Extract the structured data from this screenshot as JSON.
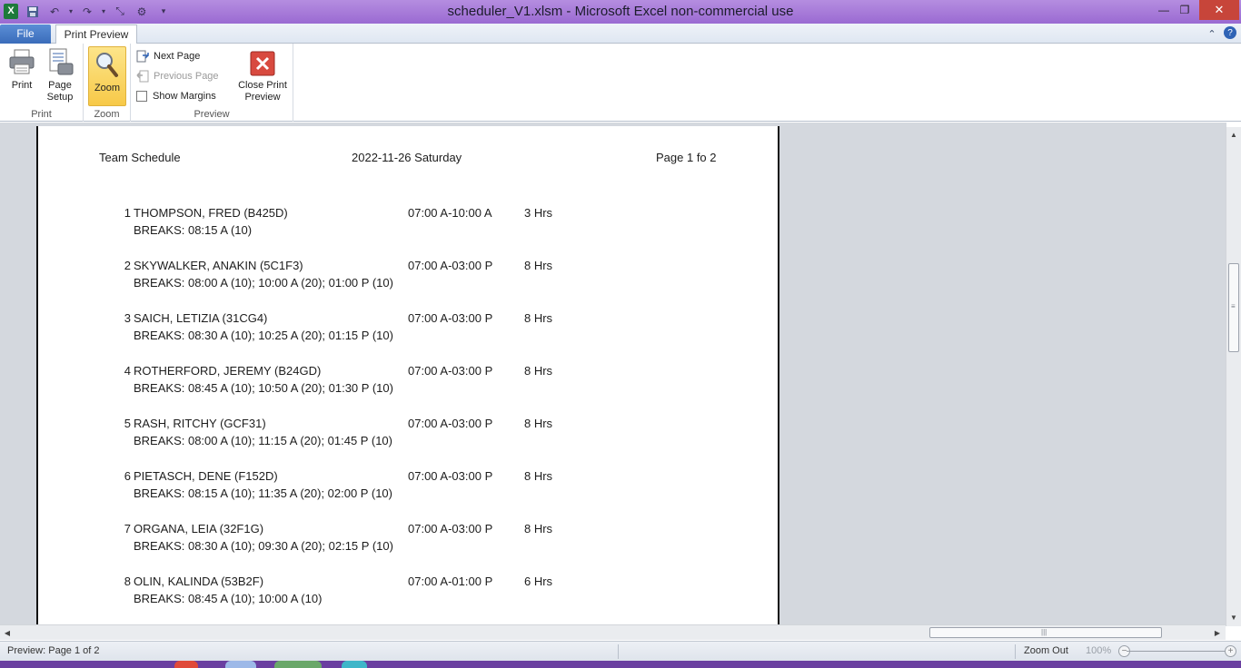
{
  "window": {
    "title": "scheduler_V1.xlsm  -  Microsoft Excel non-commercial use"
  },
  "tabs": {
    "file": "File",
    "print_preview": "Print Preview"
  },
  "ribbon": {
    "print": {
      "label": "Print",
      "group": "Print"
    },
    "page_setup": {
      "label_line1": "Page",
      "label_line2": "Setup"
    },
    "zoom": {
      "label": "Zoom",
      "group": "Zoom"
    },
    "preview": {
      "group": "Preview",
      "next_page": "Next Page",
      "previous_page": "Previous Page",
      "show_margins": "Show Margins",
      "show_margins_checked": false,
      "close_line1": "Close Print",
      "close_line2": "Preview"
    }
  },
  "page": {
    "header_left": "Team Schedule",
    "header_center": "2022-11-26 Saturday",
    "header_right": "Page 1 fo 2",
    "entries": [
      {
        "num": "1",
        "name": "THOMPSON, FRED (B425D)",
        "time": "07:00 A-10:00 A",
        "hrs": "3 Hrs",
        "breaks": "BREAKS: 08:15 A (10)"
      },
      {
        "num": "2",
        "name": "SKYWALKER, ANAKIN (5C1F3)",
        "time": "07:00 A-03:00 P",
        "hrs": "8 Hrs",
        "breaks": "BREAKS: 08:00 A (10); 10:00 A (20); 01:00 P (10)"
      },
      {
        "num": "3",
        "name": "SAICH, LETIZIA (31CG4)",
        "time": "07:00 A-03:00 P",
        "hrs": "8 Hrs",
        "breaks": "BREAKS: 08:30 A (10); 10:25 A (20); 01:15 P (10)"
      },
      {
        "num": "4",
        "name": "ROTHERFORD, JEREMY (B24GD)",
        "time": "07:00 A-03:00 P",
        "hrs": "8 Hrs",
        "breaks": "BREAKS: 08:45 A (10); 10:50 A (20); 01:30 P (10)"
      },
      {
        "num": "5",
        "name": "RASH, RITCHY (GCF31)",
        "time": "07:00 A-03:00 P",
        "hrs": "8 Hrs",
        "breaks": "BREAKS: 08:00 A (10); 11:15 A (20); 01:45 P (10)"
      },
      {
        "num": "6",
        "name": "PIETASCH, DENE (F152D)",
        "time": "07:00 A-03:00 P",
        "hrs": "8 Hrs",
        "breaks": "BREAKS: 08:15 A (10); 11:35 A (20); 02:00 P (10)"
      },
      {
        "num": "7",
        "name": "ORGANA, LEIA (32F1G)",
        "time": "07:00 A-03:00 P",
        "hrs": "8 Hrs",
        "breaks": "BREAKS: 08:30 A (10); 09:30 A (20); 02:15 P (10)"
      },
      {
        "num": "8",
        "name": "OLIN, KALINDA (53B2F)",
        "time": "07:00 A-01:00 P",
        "hrs": "6 Hrs",
        "breaks": "BREAKS: 08:45 A (10); 10:00 A (10)"
      }
    ]
  },
  "statusbar": {
    "status": "Preview: Page 1 of 2",
    "zoom_out": "Zoom Out",
    "zoom_percent": "100%"
  },
  "colors": {
    "titlebar": "#9a6ad2",
    "file_tab": "#3a6cba",
    "zoom_active": "#f7c948",
    "close_red": "#c7453a"
  }
}
